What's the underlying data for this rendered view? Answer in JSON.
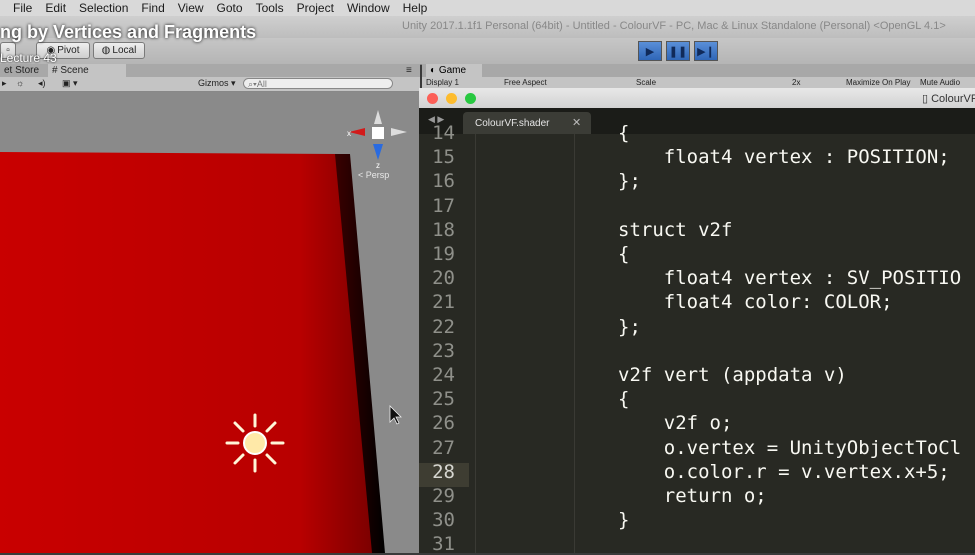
{
  "menu": [
    "File",
    "Edit",
    "Selection",
    "Find",
    "View",
    "Goto",
    "Tools",
    "Project",
    "Window",
    "Help"
  ],
  "window_title": "Unity 2017.1.1f1 Personal (64bit) - Untitled - ColourVF - PC, Mac & Linux Standalone (Personal) <OpenGL 4.1>",
  "course_title": "ng by Vertices and Fragments",
  "lecture": "Lecture 43",
  "toolbar": {
    "pivot": "Pivot",
    "local": "Local"
  },
  "tabs": {
    "asset_store": "et Store",
    "scene": "Scene",
    "game": "Game"
  },
  "scene_bar": {
    "gizmos": "Gizmos",
    "search_placeholder": "All",
    "persp": "Persp",
    "axis_x": "x",
    "axis_z": "z"
  },
  "game_bar": {
    "display": "Display 1",
    "aspect": "Free Aspect",
    "scale": "Scale",
    "scale_value": "2x",
    "maximize": "Maximize On Play",
    "mute": "Mute Audio"
  },
  "editor": {
    "filename": "ColourVF.s",
    "tab": "ColourVF.shader",
    "current_line": "28",
    "lines": [
      {
        "n": "14",
        "text": "{"
      },
      {
        "n": "15",
        "text": "    float4 vertex : POSITION;"
      },
      {
        "n": "16",
        "text": "};"
      },
      {
        "n": "17",
        "text": ""
      },
      {
        "n": "18",
        "text": "struct v2f"
      },
      {
        "n": "19",
        "text": "{"
      },
      {
        "n": "20",
        "text": "    float4 vertex : SV_POSITIO"
      },
      {
        "n": "21",
        "text": "    float4 color: COLOR;"
      },
      {
        "n": "22",
        "text": "};"
      },
      {
        "n": "23",
        "text": ""
      },
      {
        "n": "24",
        "text": "v2f vert (appdata v)"
      },
      {
        "n": "25",
        "text": "{"
      },
      {
        "n": "26",
        "text": "    v2f o;"
      },
      {
        "n": "27",
        "text": "    o.vertex = UnityObjectToCl"
      },
      {
        "n": "28",
        "text": "    o.color.r = v.vertex.x+5;"
      },
      {
        "n": "29",
        "text": "    return o;"
      },
      {
        "n": "30",
        "text": "}"
      },
      {
        "n": "31",
        "text": ""
      }
    ]
  },
  "colors": {
    "editor_bg": "#282923",
    "scene_red": "#c00000",
    "play_blue": "#3a74c8"
  }
}
